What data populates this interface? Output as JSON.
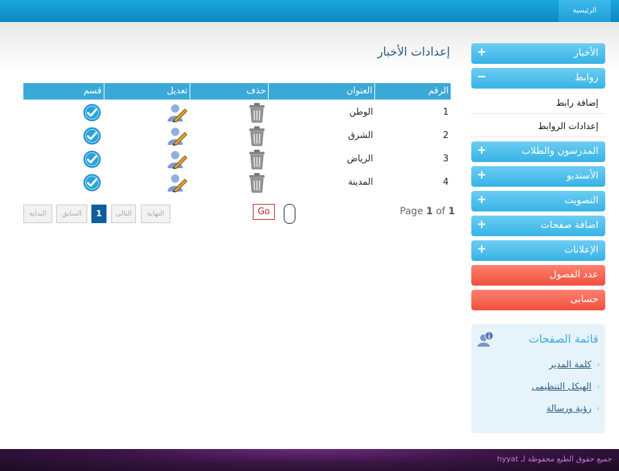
{
  "topbar": {
    "home_label": "الرئيسية"
  },
  "sidebar": {
    "menus": [
      {
        "label": "الأخبار",
        "sign": "+"
      },
      {
        "label": "روابط",
        "sign": "−"
      },
      {
        "label": "المدرسون والطلاب",
        "sign": "+"
      },
      {
        "label": "الأستديو",
        "sign": "+"
      },
      {
        "label": "التصويت",
        "sign": "+"
      },
      {
        "label": "اضافة صفحات",
        "sign": "+"
      },
      {
        "label": "الإعلانات",
        "sign": "+"
      }
    ],
    "sub_items": [
      "إضافة رابط",
      "إعدادات الروابط"
    ],
    "red_buttons": [
      "عدد الفصول",
      "حسابى"
    ]
  },
  "pages_box": {
    "title": "قائمة الصفحات",
    "icon": "user-info-icon",
    "links": [
      "كلمة المدير",
      "الهيكل التنظيمى",
      "رؤية ورسالة"
    ]
  },
  "main": {
    "title": "إعدادات الأخبار",
    "table": {
      "columns": [
        "الرقم",
        "العنوان",
        "حذف",
        "تعديل",
        "قسم"
      ],
      "rows": [
        {
          "id": "1",
          "title": "الوطن"
        },
        {
          "id": "2",
          "title": "الشرق"
        },
        {
          "id": "3",
          "title": "الرياض"
        },
        {
          "id": "4",
          "title": "المدينة"
        }
      ],
      "row_icons": {
        "delete": "trash-icon",
        "edit": "user-edit-icon",
        "section": "check-icon"
      }
    },
    "pager": {
      "page_word": "Page",
      "current": "1",
      "of_word": "of",
      "total": "1",
      "go_label": "Go",
      "buttons": [
        "النهاية",
        "التالى",
        "1",
        "السابق",
        "البداية"
      ]
    }
  },
  "footer": {
    "copyright": "جميع حقوق الطبع محفوظة لـ hyyat"
  },
  "colors": {
    "accent": "#36b3e6",
    "red_button": "#f0503e",
    "header_blue": "#0d8ac7"
  }
}
